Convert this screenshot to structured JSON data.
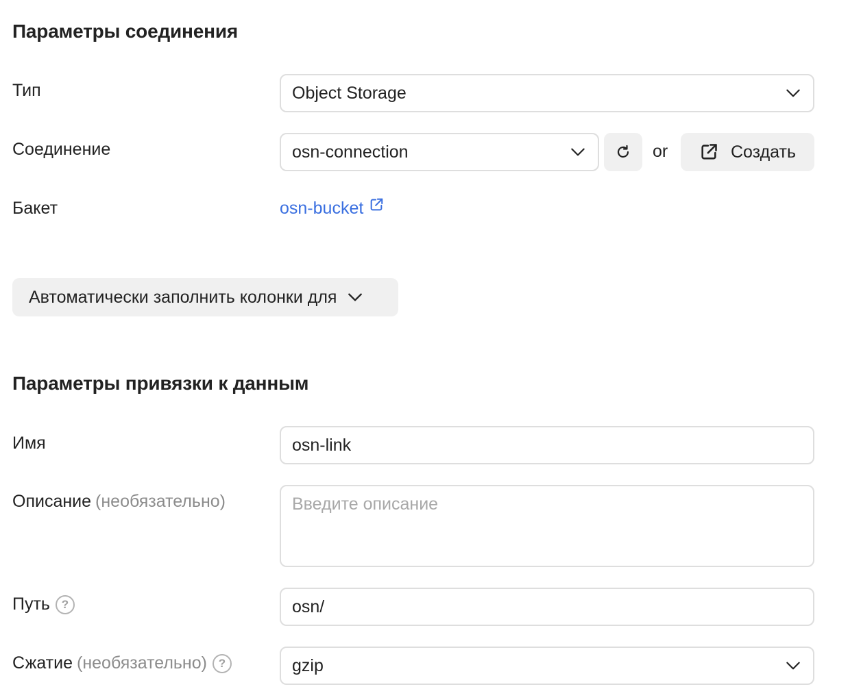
{
  "connection_section": {
    "title": "Параметры соединения",
    "type": {
      "label": "Тип",
      "value": "Object Storage"
    },
    "connection": {
      "label": "Соединение",
      "value": "osn-connection",
      "or_text": "or",
      "create_label": "Создать"
    },
    "bucket": {
      "label": "Бакет",
      "value": "osn-bucket"
    },
    "autofill_label": "Автоматически заполнить колонки для"
  },
  "binding_section": {
    "title": "Параметры привязки к данным",
    "name": {
      "label": "Имя",
      "value": "osn-link"
    },
    "description": {
      "label": "Описание",
      "hint": "(необязательно)",
      "placeholder": "Введите описание"
    },
    "path": {
      "label": "Путь",
      "value": "osn/"
    },
    "compression": {
      "label": "Сжатие",
      "hint": "(необязательно)",
      "value": "gzip"
    }
  },
  "icons": {
    "help": "?",
    "help_icon_name": "question-circle-icon",
    "chevron_icon_name": "chevron-down-icon",
    "refresh_icon_name": "refresh-icon",
    "external_link_icon_name": "external-link-icon"
  },
  "colors": {
    "link": "#3a6fe0",
    "button_bg": "#f0f0f0",
    "border": "#dedede",
    "hint": "#8c8c8c"
  }
}
